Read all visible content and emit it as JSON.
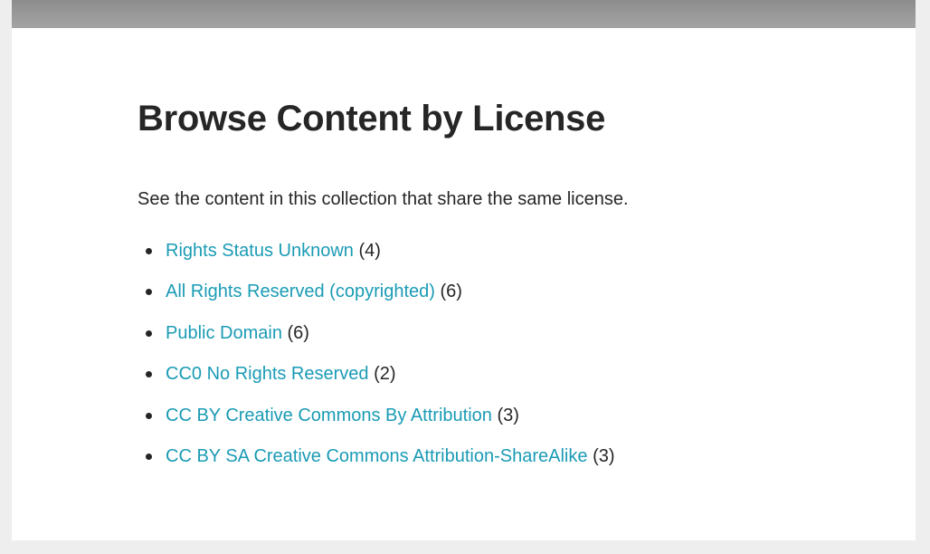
{
  "page": {
    "title": "Browse Content by License",
    "intro": "See the content in this collection that share the same license."
  },
  "licenses": [
    {
      "label": "Rights Status Unknown",
      "count": "(4)"
    },
    {
      "label": "All Rights Reserved (copyrighted)",
      "count": "(6)"
    },
    {
      "label": "Public Domain",
      "count": "(6)"
    },
    {
      "label": "CC0 No Rights Reserved",
      "count": "(2)"
    },
    {
      "label": "CC BY Creative Commons By Attribution",
      "count": "(3)"
    },
    {
      "label": "CC BY SA Creative Commons Attribution-ShareAlike",
      "count": "(3)"
    }
  ],
  "colors": {
    "link": "#1a9bb5",
    "text": "#262626",
    "background": "#eeeeee",
    "panel": "#ffffff"
  }
}
